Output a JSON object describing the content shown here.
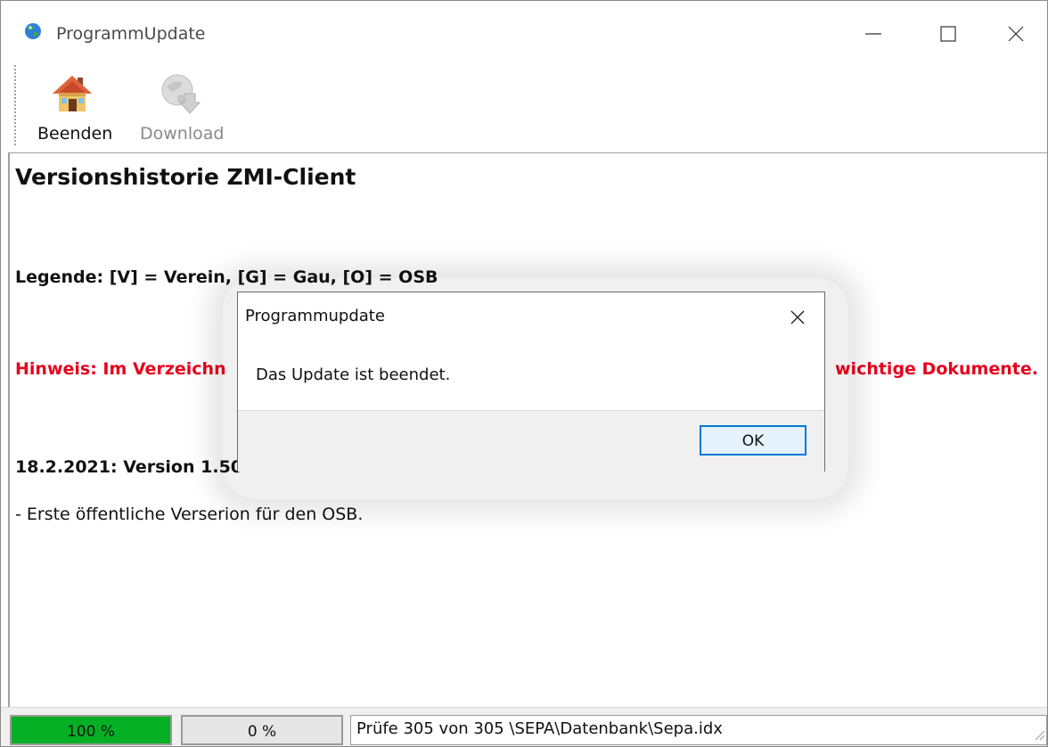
{
  "window": {
    "title": "ProgrammUpdate"
  },
  "toolbar": {
    "beenden_label": "Beenden",
    "download_label": "Download"
  },
  "content": {
    "heading": "Versionshistorie ZMI-Client",
    "legend": "Legende:  [V] = Verein,  [G] = Gau,  [O] = OSB",
    "hint_left": "Hinweis: Im Verzeichn",
    "hint_right": "wichtige Dokumente.",
    "version": "18.2.2021: Version 1.50",
    "note": "- Erste öffentliche Verserion für den OSB."
  },
  "status": {
    "progress1_text": "100 %",
    "progress1_value": 100,
    "progress2_text": "0 %",
    "progress2_value": 0,
    "message": "Prüfe 305 von 305  \\SEPA\\Datenbank\\Sepa.idx"
  },
  "dialog": {
    "title": "Programmupdate",
    "message": "Das Update ist beendet.",
    "ok_label": "OK"
  },
  "colors": {
    "hint": "#e8001c",
    "progress_fill": "#06b025",
    "focus": "#0078d7"
  },
  "icons": [
    "globe-icon",
    "minimize-icon",
    "maximize-icon",
    "close-icon",
    "home-icon",
    "download-icon"
  ]
}
